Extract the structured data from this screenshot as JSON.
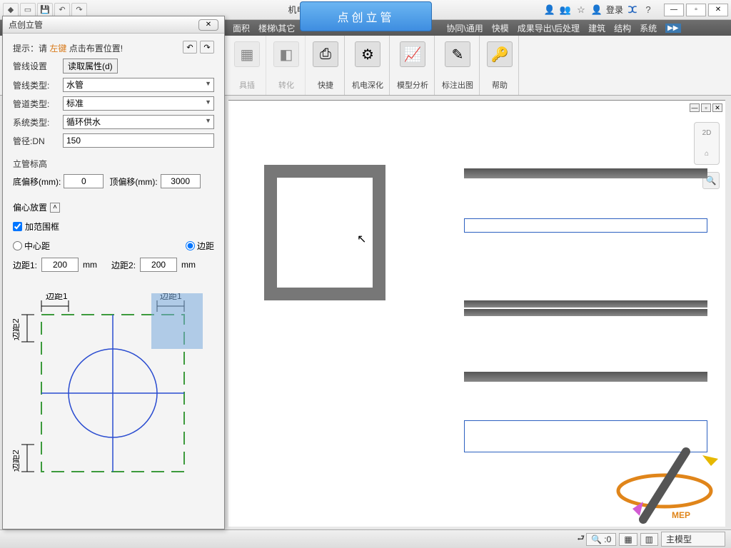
{
  "app": {
    "title": "机电V8.3 点创"
  },
  "banner": "点创立管",
  "login": "登录",
  "menubar": [
    "面积",
    "楼梯\\其它",
    "协同\\通用",
    "快模",
    "成果导出\\后处理",
    "建筑",
    "结构",
    "系统"
  ],
  "ribbon": [
    {
      "label": "具插",
      "icon": "▦",
      "disabled": true
    },
    {
      "label": "转化",
      "icon": "◧",
      "disabled": true
    },
    {
      "label": "快捷",
      "icon": "⎙"
    },
    {
      "label": "机电深化",
      "icon": "⚙"
    },
    {
      "label": "模型分析",
      "icon": "📈"
    },
    {
      "label": "标注出图",
      "icon": "✎"
    },
    {
      "label": "帮助",
      "icon": "🔑"
    }
  ],
  "dialog": {
    "title": "点创立管",
    "hint_pre": "提示：请 ",
    "hint_key": "左键",
    "hint_post": " 点击布置位置!",
    "pipeline_settings_label": "管线设置",
    "read_attr_btn": "读取属性(d)",
    "pipe_type_label": "管线类型:",
    "pipe_type_value": "水管",
    "duct_type_label": "管道类型:",
    "duct_type_value": "标准",
    "sys_type_label": "系统类型:",
    "sys_type_value": "循环供水",
    "diameter_label": "管径:DN",
    "diameter_value": "150",
    "elev_head": "立管标高",
    "bottom_offset_label": "底偏移(mm):",
    "bottom_offset_value": "0",
    "top_offset_label": "顶偏移(mm):",
    "top_offset_value": "3000",
    "eccentric_head": "偏心放置",
    "add_bbox_label": "加范围框",
    "center_dist_label": "中心距",
    "edge_dist_label": "边距",
    "edge1_label": "边距1:",
    "edge1_value": "200",
    "edge2_label": "边距2:",
    "edge2_value": "200",
    "unit_mm": "mm",
    "diag_edge1": "边距1",
    "diag_edge2": "边距2"
  },
  "statusbar": {
    "scale": ":0",
    "model": "主模型"
  }
}
